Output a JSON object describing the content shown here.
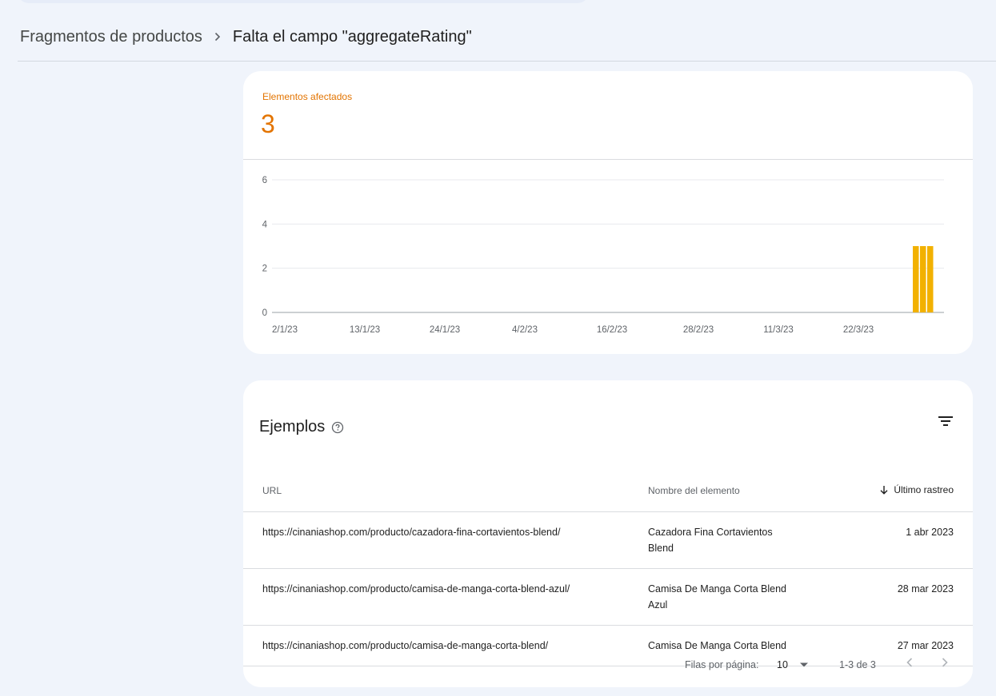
{
  "breadcrumb": {
    "parent": "Fragmentos de productos",
    "current": "Falta el campo \"aggregateRating\""
  },
  "metric": {
    "label": "Elementos afectados",
    "value": "3",
    "color": "#e37400"
  },
  "chart_data": {
    "type": "bar",
    "x_tick_labels": [
      "2/1/23",
      "13/1/23",
      "24/1/23",
      "4/2/23",
      "16/2/23",
      "28/2/23",
      "11/3/23",
      "22/3/23"
    ],
    "y_tick_labels": [
      "0",
      "2",
      "4",
      "6"
    ],
    "ylim": [
      0,
      6
    ],
    "series": [
      {
        "values": [
          3,
          3,
          3
        ],
        "x": [
          "30/3/23",
          "31/3/23",
          "1/4/23"
        ]
      }
    ],
    "bar_color": "#f2b100",
    "grid": true
  },
  "examples": {
    "title": "Ejemplos",
    "columns": {
      "url": "URL",
      "name": "Nombre del elemento",
      "date": "Último rastreo"
    },
    "rows": [
      {
        "url": "https://cinaniashop.com/producto/cazadora-fina-cortavientos-blend/",
        "name": "Cazadora Fina Cortavientos Blend",
        "date": "1 abr 2023"
      },
      {
        "url": "https://cinaniashop.com/producto/camisa-de-manga-corta-blend-azul/",
        "name": "Camisa De Manga Corta Blend Azul",
        "date": "28 mar 2023"
      },
      {
        "url": "https://cinaniashop.com/producto/camisa-de-manga-corta-blend/",
        "name": "Camisa De Manga Corta Blend",
        "date": "27 mar 2023"
      }
    ]
  },
  "pagination": {
    "rows_label": "Filas por página:",
    "rows_value": "10",
    "range": "1-3 de 3"
  },
  "icons": {
    "breadcrumb_sep": "chevron-right-icon",
    "help": "help-circle-icon",
    "filter": "filter-icon",
    "sort": "arrow-down-icon",
    "dropdown": "dropdown-icon",
    "prev": "chevron-left-icon",
    "next": "chevron-right-icon"
  }
}
